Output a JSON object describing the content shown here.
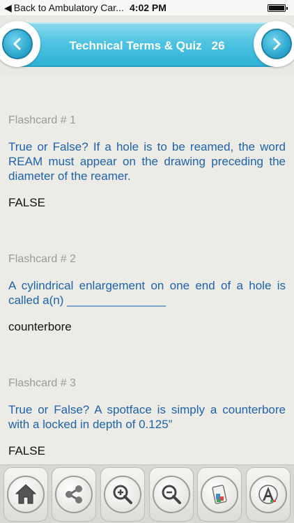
{
  "status_bar": {
    "back_label": "Back to Ambulatory Car...",
    "time": "4:02 PM",
    "battery_level": 1.0
  },
  "header": {
    "title": "Technical Terms & Quiz",
    "count": "26",
    "accent_color": "#3fbce0",
    "left_icon": "chevron-left-icon",
    "right_icon": "chevron-right-icon"
  },
  "flashcards": [
    {
      "label": "Flashcard # 1",
      "question": "True or False? If a hole is to be reamed, the word REAM must appear on the drawing preceding the diameter of the reamer.",
      "answer": "FALSE"
    },
    {
      "label": "Flashcard # 2",
      "question": "A cylindrical enlargement on one end of a hole is called a(n) _______________",
      "answer": "counterbore"
    },
    {
      "label": "Flashcard # 3",
      "question": "True or False? A spotface is simply a counterbore with a locked in depth of 0.125”",
      "answer": "FALSE"
    }
  ],
  "colors": {
    "question_text": "#1c63ad",
    "label_text": "#9a9a98",
    "answer_text": "#111111"
  },
  "toolbar": {
    "items": [
      {
        "icon": "home-icon"
      },
      {
        "icon": "share-icon"
      },
      {
        "icon": "zoom-in-icon"
      },
      {
        "icon": "zoom-out-icon"
      },
      {
        "icon": "paint-bucket-icon"
      },
      {
        "icon": "font-icon"
      }
    ]
  }
}
